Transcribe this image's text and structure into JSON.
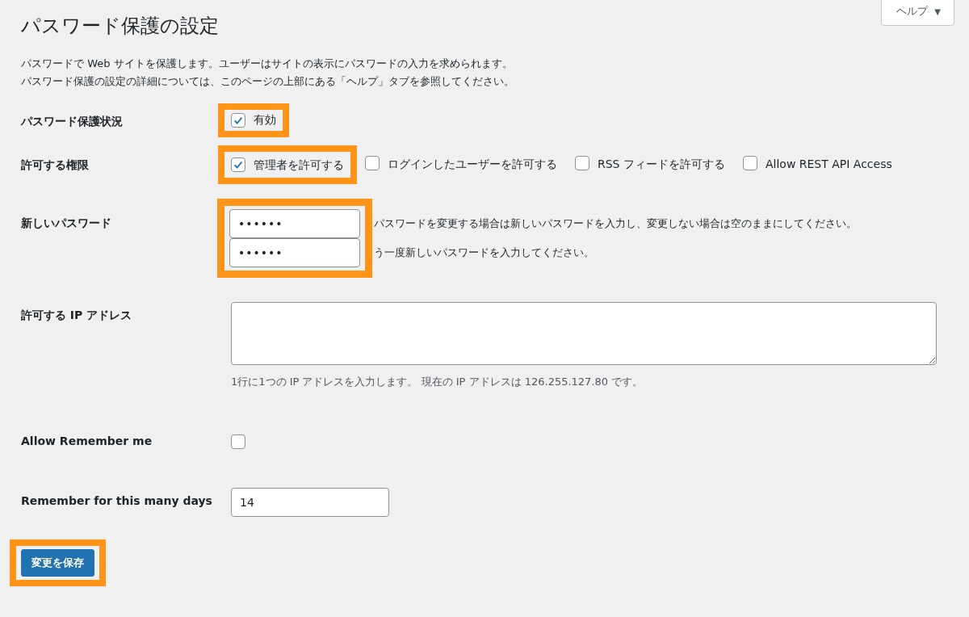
{
  "help_tab": {
    "label": "ヘルプ",
    "caret": "▼"
  },
  "title": "パスワード保護の設定",
  "description": [
    "パスワードで Web サイトを保護します。ユーザーはサイトの表示にパスワードの入力を求められます。",
    "パスワード保護の設定の詳細については、このページの上部にある「ヘルプ」タブを参照してください。"
  ],
  "status": {
    "label": "パスワード保護状況",
    "option": "有効",
    "checked": true,
    "highlighted": true
  },
  "permissions": {
    "label": "許可する権限",
    "options": [
      {
        "label": "管理者を許可する",
        "checked": true,
        "highlighted": true
      },
      {
        "label": "ログインしたユーザーを許可する",
        "checked": false,
        "highlighted": false
      },
      {
        "label": "RSS フィードを許可する",
        "checked": false,
        "highlighted": false
      },
      {
        "label": "Allow REST API Access",
        "checked": false,
        "highlighted": false
      }
    ]
  },
  "new_password": {
    "label": "新しいパスワード",
    "highlighted": true,
    "fields": [
      {
        "value": "••••••",
        "hint": "パスワードを変更する場合は新しいパスワードを入力し、変更しない場合は空のままにしてください。"
      },
      {
        "value": "••••••",
        "hint": "う一度新しいパスワードを入力してください。"
      }
    ]
  },
  "allowed_ips": {
    "label": "許可する IP アドレス",
    "hint": "1行に1つの IP アドレスを入力します。 現在の IP アドレスは 126.255.127.80 です。"
  },
  "remember_me": {
    "label": "Allow Remember me",
    "checked": false
  },
  "remember_days": {
    "label": "Remember for this many days",
    "value": "14"
  },
  "save_button": {
    "label": "変更を保存",
    "highlighted": true
  }
}
